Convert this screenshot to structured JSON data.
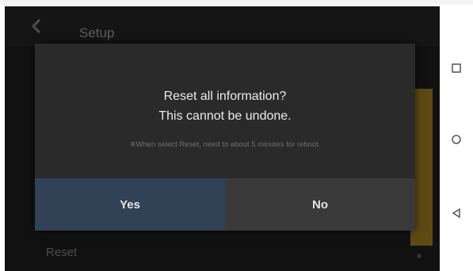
{
  "header": {
    "title": "Setup",
    "back_icon": "back-arrow-icon"
  },
  "list": {
    "bottom_item": "Reset"
  },
  "dialog": {
    "title": "Reset all information?",
    "subtitle": "This cannot be undone.",
    "note": "※When select Reset, need to about 5 minutes for reboot.",
    "yes_label": "Yes",
    "no_label": "No"
  },
  "navbar": {
    "icons": [
      "square-recent-icon",
      "circle-home-icon",
      "triangle-back-icon"
    ]
  },
  "colors": {
    "screen_bg": "#141414",
    "dialog_bg": "#2a2a2a",
    "yes_bg": "#314257",
    "no_bg": "#3a3a3a",
    "accent": "#6b5418"
  }
}
